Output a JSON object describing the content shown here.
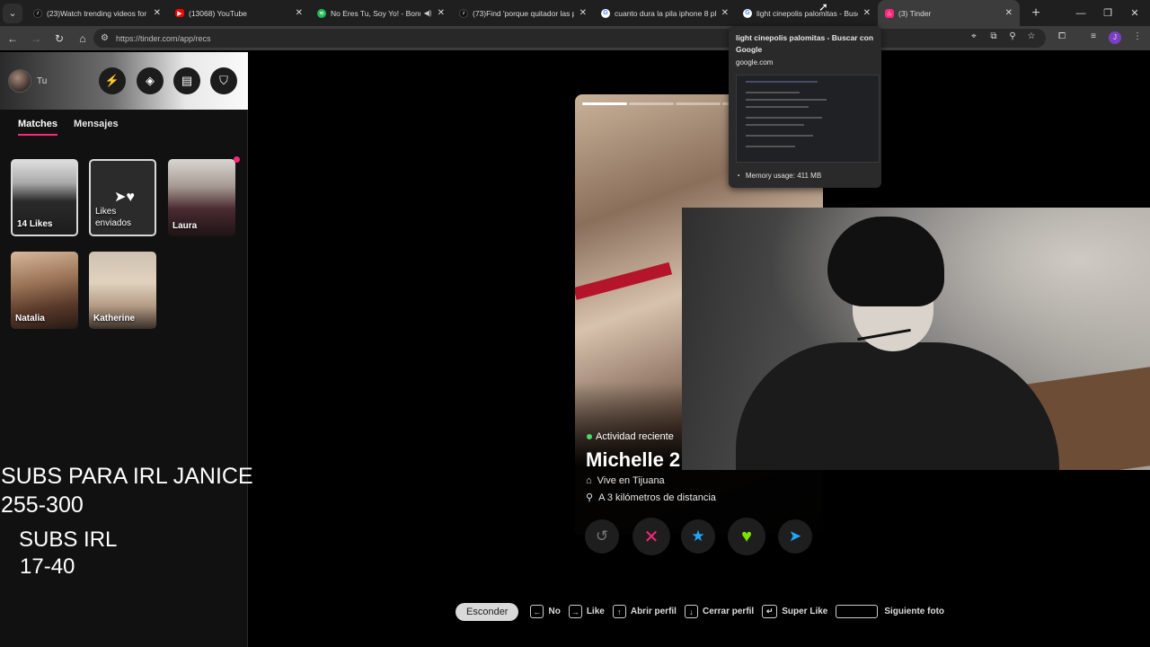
{
  "browser": {
    "tabs": [
      {
        "title": "(23)Watch trending videos for y",
        "icon": "tiktok-icon",
        "color": "#111111"
      },
      {
        "title": "(13068) YouTube",
        "icon": "youtube-icon",
        "color": "#ff0000"
      },
      {
        "title": "No Eres Tu, Soy Yo! - Bonu",
        "icon": "spotify-icon",
        "color": "#1db954",
        "muted": true
      },
      {
        "title": "(73)Find 'porque quitador las p",
        "icon": "tiktok-icon",
        "color": "#111111"
      },
      {
        "title": "cuanto dura la pila iphone 8 pl",
        "icon": "google-icon",
        "color": "#ffffff"
      },
      {
        "title": "light cinepolis palomitas - Busc",
        "icon": "google-icon",
        "color": "#ffffff"
      },
      {
        "title": "(3) Tinder",
        "icon": "tinder-icon",
        "color": "#fd267a",
        "active": true
      }
    ],
    "url": "https://tinder.com/app/recs",
    "tooltip": {
      "title": "light cinepolis palomitas - Buscar con Google",
      "host": "google.com",
      "memory": "Memory usage: 411 MB"
    },
    "profile_initial": "J"
  },
  "sidebar": {
    "user_name": "Tu",
    "tabs": {
      "matches": "Matches",
      "messages": "Mensajes"
    },
    "cards": {
      "likes": "14 Likes",
      "sent_line1": "Likes",
      "sent_line2": "enviados",
      "laura": "Laura",
      "natalia": "Natalia",
      "katherine": "Katherine"
    }
  },
  "overlay": {
    "line1": "SUBS PARA IRL JANICE",
    "line2": "255-300",
    "line3": "SUBS IRL",
    "line4": "17-40"
  },
  "profile": {
    "activity": "Actividad reciente",
    "name": "Michelle 2",
    "lives": "Vive en Tijuana",
    "distance": "A 3 kilómetros de distancia",
    "photo_count": 5,
    "active_photo": 1
  },
  "shortcuts": {
    "hide": "Esconder",
    "no": "No",
    "like": "Like",
    "open_profile": "Abrir perfil",
    "close_profile": "Cerrar perfil",
    "super_like": "Super Like",
    "next_photo": "Siguiente foto"
  },
  "colors": {
    "tinder_pink": "#fd267a",
    "nope": "#fd267a",
    "super_like": "#1ea7fd",
    "like": "#7ee000",
    "boost": "#1ea7fd"
  }
}
